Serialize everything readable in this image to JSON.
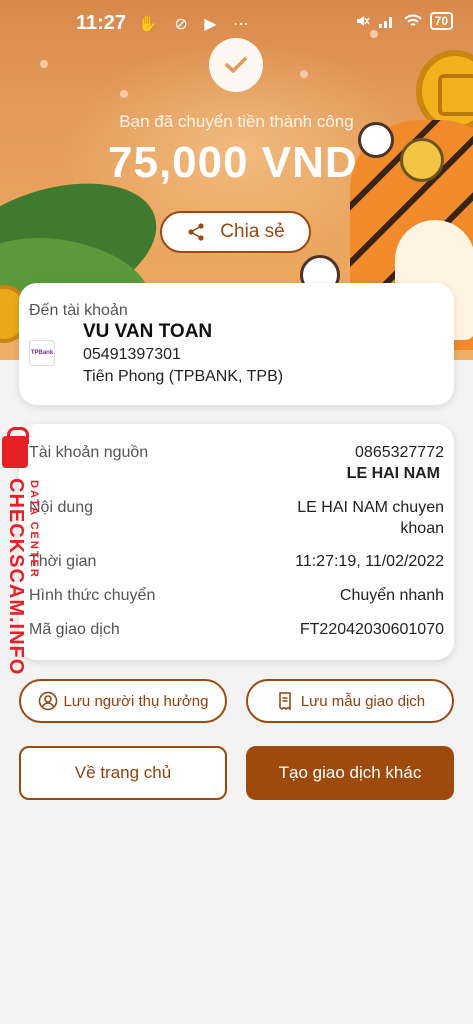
{
  "status_bar": {
    "time": "11:27",
    "left_icons": "✋ ⊘ ▶ ⋯",
    "battery": "70"
  },
  "header": {
    "success_text": "Bạn đã chuyển tiền thành công",
    "amount": "75,000 VND",
    "share_label": "Chia sẻ"
  },
  "recipient": {
    "label": "Đến tài khoản",
    "bank_logo_text": "TPBank",
    "name": "VU VAN TOAN",
    "account_number": "05491397301",
    "bank": "Tiên Phong (TPBANK, TPB)"
  },
  "details": {
    "source_label": "Tài khoản nguồn",
    "source_account": "0865327772",
    "source_name": "LE HAI NAM",
    "content_label": "Nội dung",
    "content_line1": "LE HAI NAM chuyen",
    "content_line2": "khoan",
    "time_label": "Thời gian",
    "time_value": "11:27:19, 11/02/2022",
    "method_label": "Hình thức chuyển",
    "method_value": "Chuyển nhanh",
    "code_label": "Mã giao dịch",
    "code_value": "FT22042030601070"
  },
  "actions": {
    "save_beneficiary": "Lưu người thụ hưởng",
    "save_template": "Lưu mẫu giao dịch",
    "home": "Về trang chủ",
    "new_transaction": "Tạo giao dịch khác"
  },
  "watermark": {
    "main": "CHECKSCAM.INFO",
    "sub": "DATA CENTER"
  },
  "colors": {
    "brand": "#9d4a0c",
    "watermark": "#e62024"
  }
}
